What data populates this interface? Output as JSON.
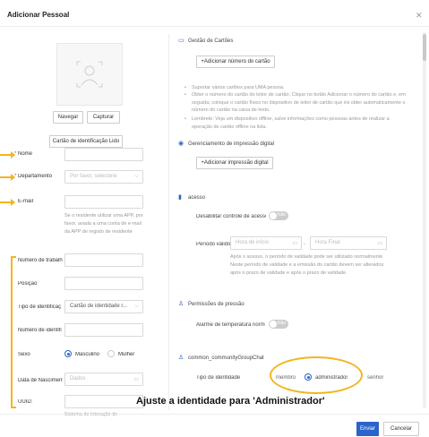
{
  "dialog": {
    "title": "Adicionar Pessoal"
  },
  "photo": {
    "browse_label": "Navegar",
    "capture_label": "Capturar"
  },
  "left": {
    "id_card_label": "Cartão de identificação Lido",
    "name_label": "Nome",
    "department_label": "Departamento",
    "department_placeholder": "Por favor, selecione",
    "email_label": "E-mail",
    "email_hint": "Se o residente utilizar uma APP, por favor, avada a uma conta de e-mail da APP de registo de residente",
    "work_number_label": "Número de trabalh",
    "position_label": "Posição",
    "id_type_label": "Tipo de identificaç",
    "id_type_value": "Cartão de identidade r...",
    "id_number_label": "Número de identifi",
    "sex_label": "Sexo",
    "sex_male": "Masculino",
    "sex_female": "Mulher",
    "birth_label": "Data de Nasciment",
    "birth_placeholder": "Dados",
    "uuid_label": "UUID:",
    "uuid_hint": "Sistema de interação de"
  },
  "cards": {
    "title": "Gestão de Cartões",
    "add_label": "+Adicionar número do cartão",
    "bullets": [
      "Suportar vários cartões para UMA pessoa.",
      "Obter o número do cartão do leitor de cartão: Clique no botão Adicionar o número do cartão e, em seguida, coloque o cartão físico no dispositivo de leitor de cartão que irá obter automaticamente o número do cartão na caixa de texto.",
      "Lembrete: Veja um dispositivo offline, salve informações como pessoas antes de realizar a operação de cartão offline na lista."
    ]
  },
  "fingerprint": {
    "title": "Gerenciamento de impressão digital",
    "add_label": "+Adicionar impressão digital"
  },
  "access": {
    "title": "acesso",
    "disable_label": "Desabilitar controle de acesso",
    "toggle_label": "Não",
    "validity_label": "Período válido:",
    "start_placeholder": "Hora de início",
    "end_placeholder": "Hora Final",
    "validity_hint": "Após o acesso, o período de validade pode ser utilizado normalmente Neste período de validade e a emissão do cartão devem ser alterados após o prazo de validade e após o prazo de validade."
  },
  "pressure": {
    "title": "Permissões de pressão",
    "alarm_label": "Alarme de temperatura norm",
    "toggle_label": "Não"
  },
  "community": {
    "title": "common_communityGroupChat",
    "identity_label": "Tipo de identidade",
    "member_label": "membro",
    "admin_label": "administrador",
    "lord_label": "senhor"
  },
  "annotation": {
    "callout": "Ajuste a identidade para 'Administrador'"
  },
  "footer": {
    "submit_label": "Enviar",
    "cancel_label": "Cancelar"
  },
  "colors": {
    "accent": "#2a63c9",
    "annotation": "#f2b51f"
  }
}
